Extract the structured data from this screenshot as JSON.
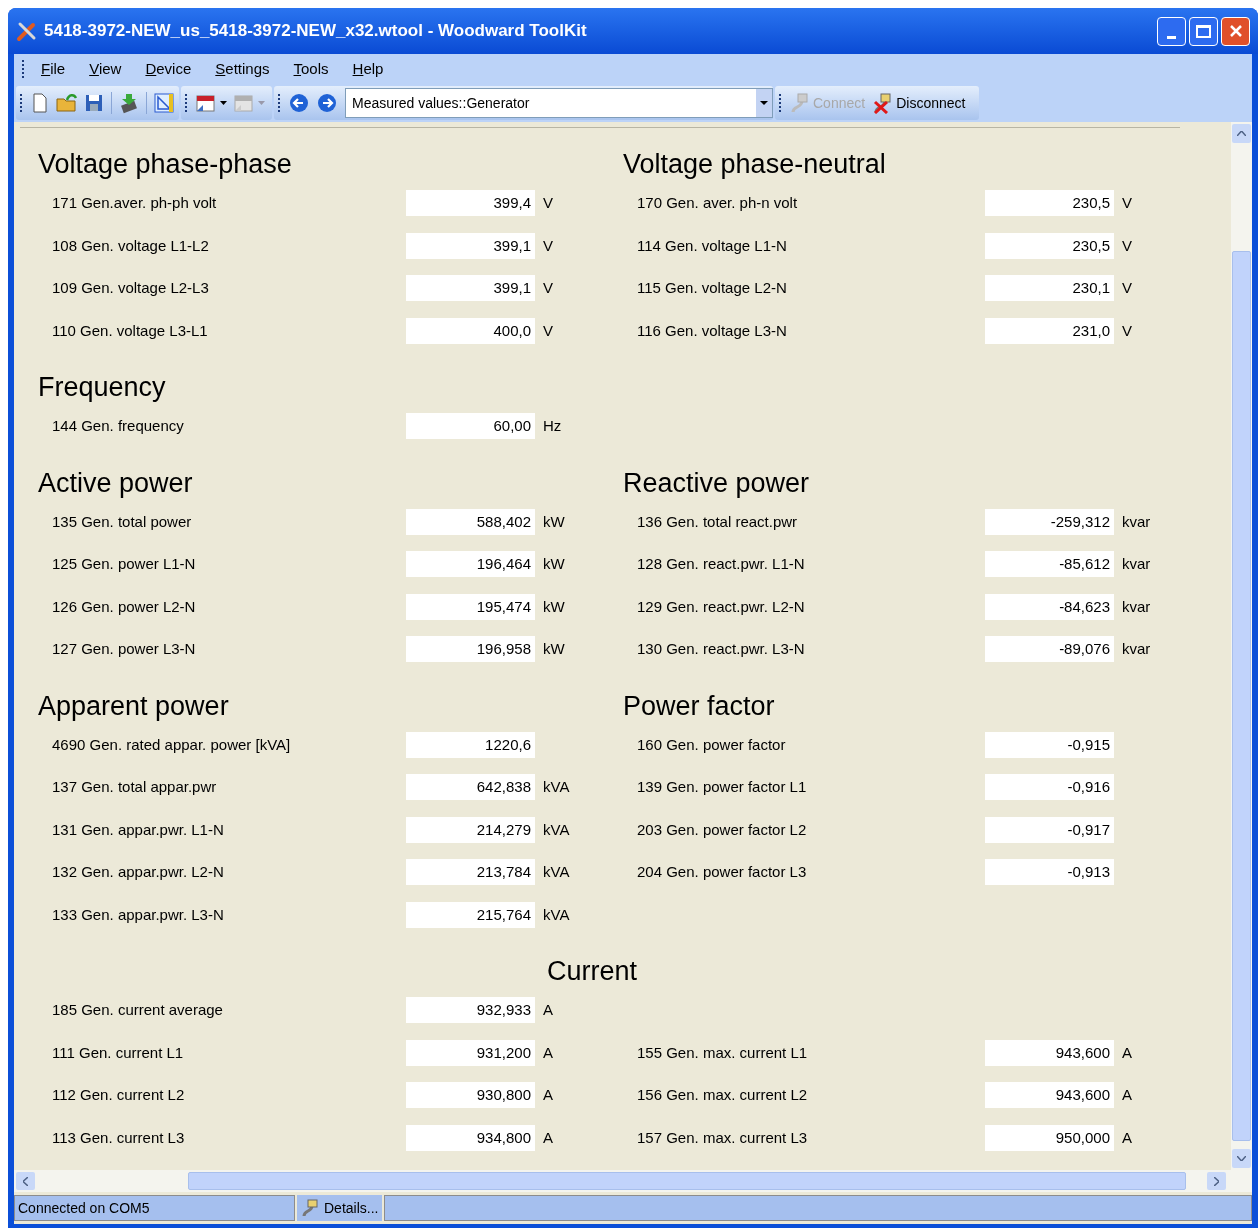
{
  "window": {
    "title": "5418-3972-NEW_us_5418-3972-NEW_x32.wtool - Woodward ToolKit"
  },
  "menu": [
    "File",
    "View",
    "Device",
    "Settings",
    "Tools",
    "Help"
  ],
  "toolbar": {
    "calendar_buttons": [
      {
        "disabled": false
      },
      {
        "disabled": true
      }
    ],
    "page_select": {
      "value": "Measured values::Generator"
    },
    "connection_buttons": [
      {
        "kind": "connect",
        "label": "Connect",
        "disabled": true
      },
      {
        "kind": "disconnect",
        "label": "Disconnect",
        "disabled": false
      }
    ]
  },
  "groups": [
    {
      "kind": "pair",
      "left": {
        "title": "Voltage phase-phase",
        "rows": [
          {
            "label": "171 Gen.aver. ph-ph volt",
            "value": "399,4",
            "unit": "V"
          },
          {
            "label": "108 Gen. voltage L1-L2",
            "value": "399,1",
            "unit": "V"
          },
          {
            "label": "109 Gen. voltage L2-L3",
            "value": "399,1",
            "unit": "V"
          },
          {
            "label": "110 Gen. voltage L3-L1",
            "value": "400,0",
            "unit": "V"
          }
        ]
      },
      "right": {
        "title": "Voltage phase-neutral",
        "rows": [
          {
            "label": "170 Gen. aver. ph-n volt",
            "value": "230,5",
            "unit": "V"
          },
          {
            "label": "114 Gen. voltage L1-N",
            "value": "230,5",
            "unit": "V"
          },
          {
            "label": "115 Gen. voltage L2-N",
            "value": "230,1",
            "unit": "V"
          },
          {
            "label": "116 Gen. voltage L3-N",
            "value": "231,0",
            "unit": "V"
          }
        ]
      }
    },
    {
      "kind": "pair",
      "left": {
        "title": "Frequency",
        "rows": [
          {
            "label": "144 Gen. frequency",
            "value": "60,00",
            "unit": "Hz"
          }
        ]
      }
    },
    {
      "kind": "pair",
      "left": {
        "title": "Active power",
        "rows": [
          {
            "label": "135 Gen. total power",
            "value": "588,402",
            "unit": "kW"
          },
          {
            "label": "125 Gen. power L1-N",
            "value": "196,464",
            "unit": "kW"
          },
          {
            "label": "126 Gen. power L2-N",
            "value": "195,474",
            "unit": "kW"
          },
          {
            "label": "127 Gen. power L3-N",
            "value": "196,958",
            "unit": "kW"
          }
        ]
      },
      "right": {
        "title": "Reactive power",
        "rows": [
          {
            "label": "136 Gen. total react.pwr",
            "value": "-259,312",
            "unit": "kvar"
          },
          {
            "label": "128 Gen. react.pwr. L1-N",
            "value": "-85,612",
            "unit": "kvar"
          },
          {
            "label": "129 Gen. react.pwr. L2-N",
            "value": "-84,623",
            "unit": "kvar"
          },
          {
            "label": "130 Gen. react.pwr. L3-N",
            "value": "-89,076",
            "unit": "kvar"
          }
        ]
      }
    },
    {
      "kind": "pair",
      "left": {
        "title": "Apparent power",
        "rows": [
          {
            "label": "4690 Gen. rated appar. power [kVA]",
            "value": "1220,6"
          },
          {
            "label": "137 Gen. total appar.pwr",
            "value": "642,838",
            "unit": "kVA"
          },
          {
            "label": "131 Gen. appar.pwr. L1-N",
            "value": "214,279",
            "unit": "kVA"
          },
          {
            "label": "132 Gen. appar.pwr. L2-N",
            "value": "213,784",
            "unit": "kVA"
          },
          {
            "label": "133 Gen. appar.pwr. L3-N",
            "value": "215,764",
            "unit": "kVA"
          }
        ]
      },
      "right": {
        "title": "Power factor",
        "rows": [
          {
            "label": "160 Gen. power factor",
            "value": "-0,915"
          },
          {
            "label": "139 Gen. power factor L1",
            "value": "-0,916"
          },
          {
            "label": "203 Gen. power factor L2",
            "value": "-0,917"
          },
          {
            "label": "204 Gen. power factor L3",
            "value": "-0,913"
          }
        ]
      }
    },
    {
      "kind": "split",
      "title": "Current",
      "left": {
        "rows": [
          {
            "label": "185 Gen. current average",
            "value": "932,933",
            "unit": "A"
          },
          {
            "label": "111 Gen. current L1",
            "value": "931,200",
            "unit": "A"
          },
          {
            "label": "112 Gen. current L2",
            "value": "930,800",
            "unit": "A"
          },
          {
            "label": "113 Gen. current L3",
            "value": "934,800",
            "unit": "A"
          }
        ]
      },
      "right": {
        "rows": [
          {
            "label": "155 Gen. max. current L1",
            "value": "943,600",
            "unit": "A"
          },
          {
            "label": "156 Gen. max. current L2",
            "value": "943,600",
            "unit": "A"
          },
          {
            "label": "157 Gen. max. current L3",
            "value": "950,000",
            "unit": "A"
          }
        ]
      }
    }
  ],
  "status_bar": {
    "connection": "Connected on COM5",
    "details_button": "Details..."
  }
}
